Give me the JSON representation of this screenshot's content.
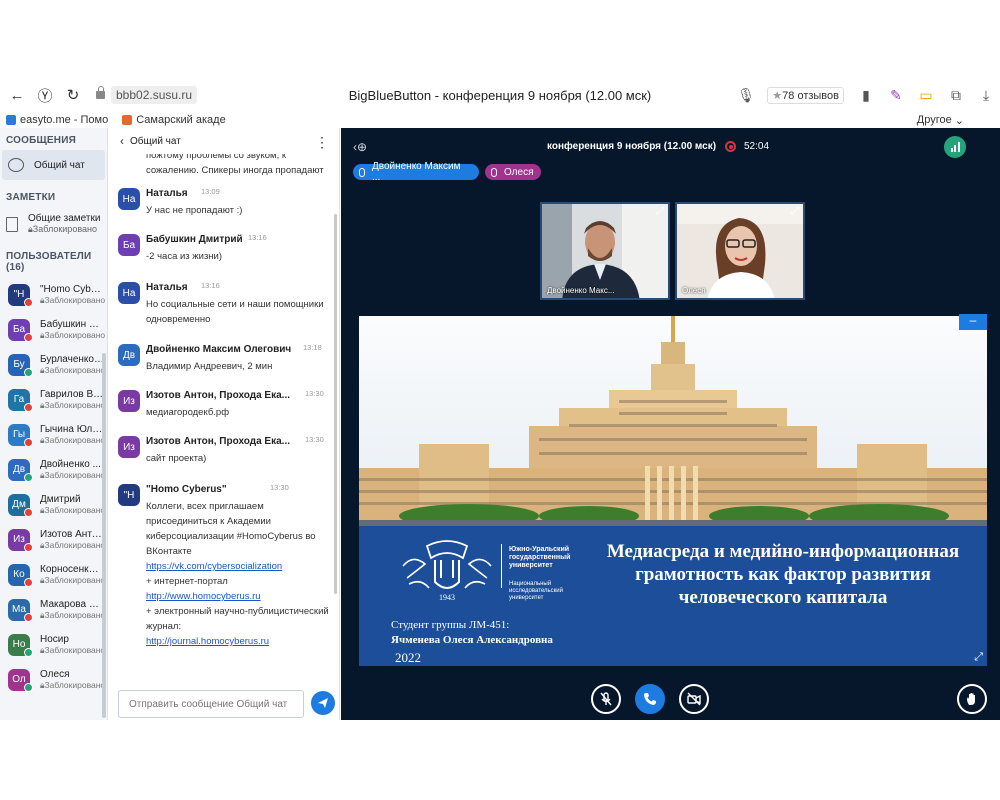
{
  "browser": {
    "back_icon": "back-arrow-icon",
    "url": "bbb02.susu.ru",
    "title": "BigBlueButton - конференция 9 ноября (12.00 мск)",
    "reviews": "78 отзывов",
    "bookmarks": [
      "easyto.me - Помо",
      "Самарский акаде"
    ],
    "other_bookmarks": "Другое"
  },
  "sidebar": {
    "messages_header": "СООБЩЕНИЯ",
    "public_chat": "Общий чат",
    "notes_header": "ЗАМЕТКИ",
    "notes_title": "Общие заметки",
    "notes_status": "Заблокировано",
    "users_header": "ПОЛЬЗОВАТЕЛИ (16)",
    "users": [
      {
        "initials": "\"Н",
        "name": "\"Homo Cyber...",
        "status": "Заблокировано",
        "color": "#213a80",
        "badge": "#e0403f"
      },
      {
        "initials": "Ба",
        "name": "Бабушкин Д...",
        "status": "Заблокировано",
        "color": "#6d3fb3",
        "badge": "#e0403f"
      },
      {
        "initials": "Бу",
        "name": "Бурлаченко ...",
        "status": "Заблокировано",
        "color": "#2565b8",
        "badge": "#23a47b"
      },
      {
        "initials": "Га",
        "name": "Гаврилов Ви...",
        "status": "Заблокировано",
        "color": "#1f75a8",
        "badge": "#e0403f"
      },
      {
        "initials": "Гы",
        "name": "Гычина Юли...",
        "status": "Заблокировано",
        "color": "#2d7bc4",
        "badge": "#e0403f"
      },
      {
        "initials": "Дв",
        "name": "Двойненко ...",
        "status": "Заблокировано",
        "color": "#2c6bbf",
        "badge": "#23a47b"
      },
      {
        "initials": "Дм",
        "name": "Дмитрий",
        "status": "Заблокировано",
        "color": "#1f6f9e",
        "badge": "#e0403f"
      },
      {
        "initials": "Из",
        "name": "Изотов Анто...",
        "status": "Заблокировано",
        "color": "#7a3aa3",
        "badge": "#e0403f"
      },
      {
        "initials": "Ко",
        "name": "Корносенко ...",
        "status": "Заблокировано",
        "color": "#2466b0",
        "badge": "#e0403f"
      },
      {
        "initials": "Ма",
        "name": "Макарова С...",
        "status": "Заблокировано",
        "color": "#2b6aa8",
        "badge": "#e0403f"
      },
      {
        "initials": "Но",
        "name": "Носир",
        "status": "Заблокировано",
        "color": "#3a7d4a",
        "badge": "#23a47b"
      },
      {
        "initials": "Ол",
        "name": "Олеся",
        "status": "Заблокировано",
        "color": "#a0338e",
        "badge": "#23a47b"
      }
    ]
  },
  "chat": {
    "title": "Общий чат",
    "cut_text": "пожтому проблемы со звуком, к сожалению. Спикеры иногда пропадают",
    "messages": [
      {
        "initials": "На",
        "name": "Наталья",
        "time": "13:09",
        "lines": [
          "У нас не пропадают :)"
        ],
        "color": "#2b4fa8"
      },
      {
        "initials": "Ба",
        "name": "Бабушкин Дмитрий",
        "time": "13:16",
        "lines": [
          "-2 часа из жизни)"
        ],
        "color": "#6d3fb3"
      },
      {
        "initials": "На",
        "name": "Наталья",
        "time": "13:16",
        "lines": [
          "Но социальные сети и наши помощники одновременно"
        ],
        "color": "#2b4fa8"
      },
      {
        "initials": "Дв",
        "name": "Двойненко Максим Олегович",
        "time": "13:18",
        "lines": [
          "Владимир Андреевич, 2 мин"
        ],
        "color": "#2c6bbf"
      },
      {
        "initials": "Из",
        "name": "Изотов Антон, Прохода Ека...",
        "time": "13:30",
        "lines": [
          "медиагородекб.рф"
        ],
        "color": "#7a3aa3"
      },
      {
        "initials": "Из",
        "name": "Изотов Антон, Прохода Ека...",
        "time": "13:30",
        "lines": [
          "сайт проекта)"
        ],
        "color": "#7a3aa3"
      },
      {
        "initials": "\"Н",
        "name": "\"Homo Cyberus\"",
        "time": "13:30",
        "color": "#213a80",
        "lines": [
          "Коллеги, всех приглашаем присоединиться к Академии киберсоциализации #HomoCyberus во ВКонтакте"
        ],
        "link1": "https://vk.com/cybersocialization",
        "text2": "+ интернет-портал",
        "link2": "http://www.homocyberus.ru",
        "text3": "+ электронный научно-публицистический журнал:",
        "link3": "http://journal.homocyberus.ru"
      }
    ],
    "input_placeholder": "Отправить сообщение Общий чат"
  },
  "conference": {
    "title": "конференция 9 ноября (12.00 мск)",
    "timer": "52:04",
    "talkers": [
      {
        "name": "Двойненко Максим ...",
        "color": "#1e7be0"
      },
      {
        "name": "Олеся",
        "color": "#a0338e"
      }
    ],
    "videos": [
      {
        "name": "Двойненко Макс..."
      },
      {
        "name": "Олеся"
      }
    ],
    "slide": {
      "title": "Медиасреда и медийно-информационная грамотность как фактор развития человеческого капитала",
      "uni_name": "Южно-Уральский государственный университет",
      "uni_sub": "Национальный исследовательский университет",
      "founded": "1943",
      "student_line1": "Студент группы ЛМ-451:",
      "student_line2": "Ячменева Олеся Александровна",
      "year": "2022"
    }
  },
  "colors": {
    "accent": "#1e7be0",
    "conference_bg": "#06172b",
    "slide_blue": "#1c4e9a"
  }
}
